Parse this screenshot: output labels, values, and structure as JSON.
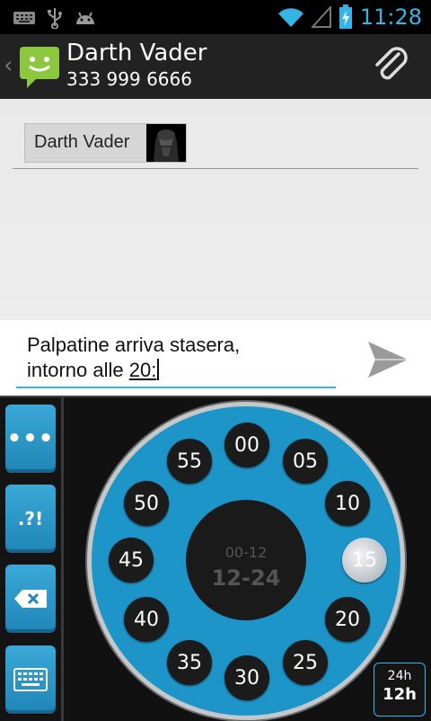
{
  "status_bar": {
    "time": "11:28",
    "icons": [
      "keyboard-icon",
      "usb-icon",
      "android-debug-icon",
      "wifi-icon",
      "signal-icon",
      "battery-charging-icon"
    ],
    "accent_color": "#33b5e5"
  },
  "action_bar": {
    "contact_name": "Darth Vader",
    "contact_number": "333 999 6666",
    "icons": [
      "back-chevron-icon",
      "messaging-app-icon",
      "attach-paperclip-icon"
    ]
  },
  "conversation": {
    "recipient_chip_name": "Darth Vader"
  },
  "composer": {
    "line1": "Palpatine arriva stasera,",
    "line2_prefix": "intorno alle ",
    "line2_composing": "20:",
    "underline_color": "#33b5e5"
  },
  "keyboard": {
    "side_buttons": [
      {
        "name": "more-options",
        "label": "•••"
      },
      {
        "name": "punctuation",
        "label": ".?!"
      },
      {
        "name": "backspace",
        "label": ""
      },
      {
        "name": "keyboard-switch",
        "label": ""
      }
    ],
    "dial_minutes": [
      "00",
      "05",
      "10",
      "15",
      "20",
      "25",
      "30",
      "35",
      "40",
      "45",
      "50",
      "55"
    ],
    "selected_minute": "15",
    "center_top": "00-12",
    "center_bottom": "12-24",
    "mode_button": {
      "top": "24h",
      "bottom": "12h"
    },
    "dial_color": "#1e95c8"
  }
}
